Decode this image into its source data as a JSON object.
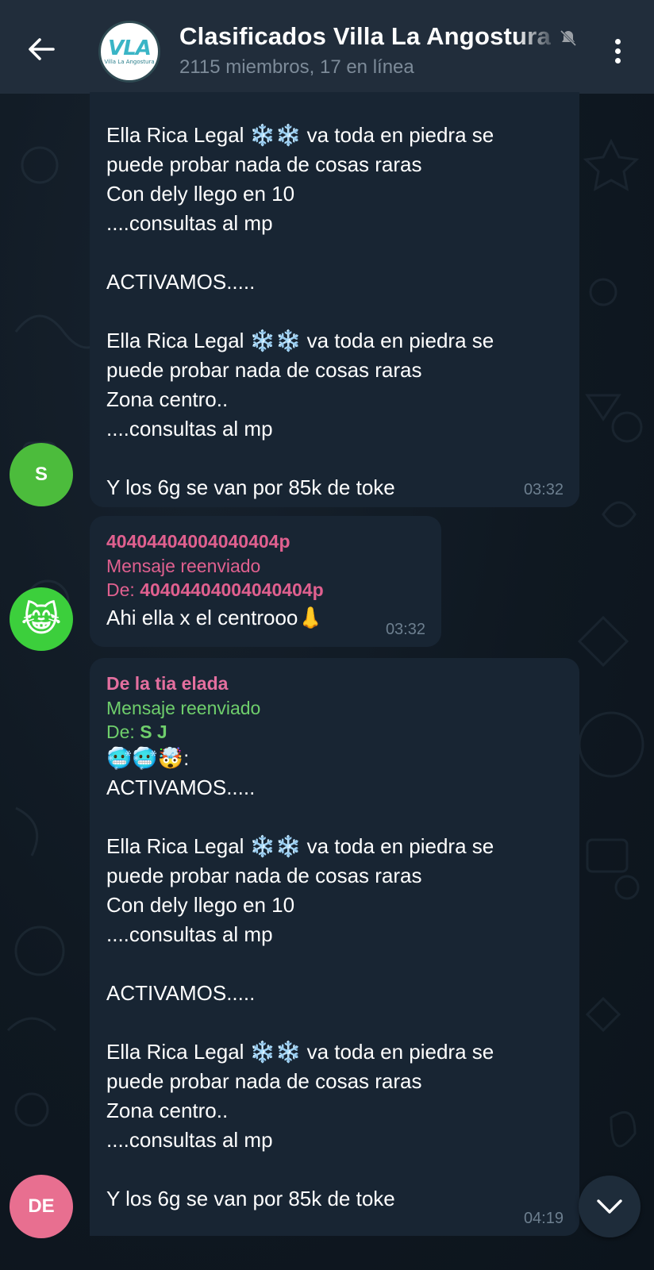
{
  "header": {
    "back_icon": "arrow-left-icon",
    "avatar_logo_text": "VLA",
    "avatar_logo_subtext": "Villa La Angostura",
    "title": "Clasificados Villa La Angostura",
    "subtitle": "2115 miembros, 17 en línea",
    "mute_icon": "muted-bell-icon",
    "menu_icon": "more-vertical-icon"
  },
  "messages": [
    {
      "id": "msg1",
      "lines": [
        "Ella Rica Legal ❄️❄️ va toda en piedra se",
        "puede probar nada de cosas raras",
        "Con dely llego en 10",
        "....consultas al mp",
        "",
        "ACTIVAMOS.....",
        "",
        "Ella Rica Legal ❄️❄️ va toda en piedra se",
        "puede probar nada de cosas raras",
        "Zona centro..",
        "....consultas al mp",
        "",
        "Y los 6g se van por 85k de toke"
      ],
      "time": "03:32",
      "avatar_initial": "S",
      "avatar_color": "#4cbc3c"
    },
    {
      "id": "msg2",
      "sender": "40404404004040404p",
      "sender_color": "#e0608f",
      "forward_label": "Mensaje reenviado",
      "forward_from_prefix": "De: ",
      "forward_from": "40404404004040404p",
      "forward_color": "#e0608f",
      "text": "Ahi ella x el centrooo👃",
      "time": "03:32",
      "avatar_emoji": "😹",
      "avatar_color": "#3ccf3c"
    },
    {
      "id": "msg3",
      "sender": "De la tia elada",
      "sender_color": "#e46f9f",
      "forward_label": "Mensaje reenviado",
      "forward_from_prefix": "De: ",
      "forward_from": "S J",
      "forward_color": "#6fcf6c",
      "lines": [
        "🥶🥶🤯:",
        "ACTIVAMOS.....",
        "",
        "Ella Rica Legal ❄️❄️ va toda en piedra se",
        "puede probar nada de cosas raras",
        "Con dely llego en 10",
        "....consultas al mp",
        "",
        "ACTIVAMOS.....",
        "",
        "Ella Rica Legal ❄️❄️ va toda en piedra se",
        "puede probar nada de cosas raras",
        "Zona centro..",
        "....consultas al mp",
        "",
        "Y los 6g se van por 85k de toke"
      ],
      "time": "04:19",
      "avatar_initial": "DE",
      "avatar_color": "#e86f90"
    }
  ],
  "scroll_down_icon": "chevron-down-icon",
  "colors": {
    "header_bg": "#212d3b",
    "bubble_bg": "#182533",
    "chat_bg": "#0e1621",
    "muted_text": "#7d8b99"
  }
}
